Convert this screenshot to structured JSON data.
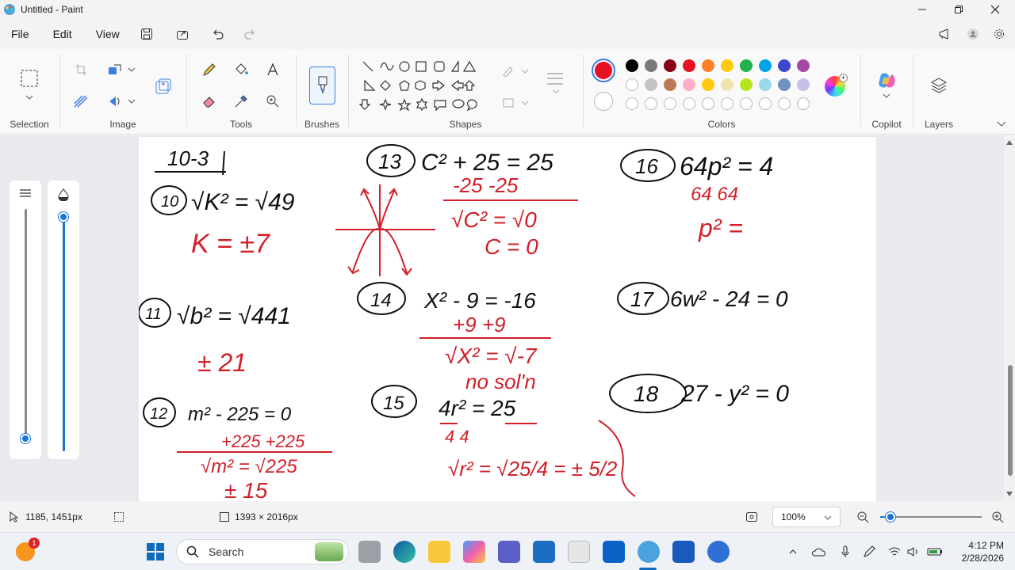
{
  "window": {
    "title": "Untitled - Paint"
  },
  "menu": {
    "file": "File",
    "edit": "Edit",
    "view": "View"
  },
  "ribbon": {
    "groups": {
      "selection": "Selection",
      "image": "Image",
      "tools": "Tools",
      "brushes": "Brushes",
      "shapes": "Shapes",
      "colors": "Colors",
      "copilot": "Copilot",
      "layers": "Layers"
    },
    "primary_color": "#e81123",
    "palette_row1": [
      "#000000",
      "#7a7a7a",
      "#880015",
      "#e81123",
      "#ff7f27",
      "#ffc90e",
      "#22b14c",
      "#00a2e8",
      "#3f48cc",
      "#a349a4"
    ],
    "palette_row2": [
      "#ffffff",
      "#c3c3c3",
      "#b97a57",
      "#ffaec9",
      "#ffc90e",
      "#efe4b0",
      "#b5e61d",
      "#99d9ea",
      "#7092be",
      "#c8bfe7"
    ]
  },
  "canvas_notes": {
    "header": "10-3",
    "problems": [
      {
        "num": "10",
        "equation": "√K² = √49",
        "work": [
          "K = ±7"
        ]
      },
      {
        "num": "11",
        "equation": "√b² = √441",
        "work": [
          "± 21"
        ]
      },
      {
        "num": "12",
        "equation": "m² - 225 = 0",
        "work": [
          "+225 +225",
          "√m² = √225",
          "± 15"
        ]
      },
      {
        "num": "13",
        "equation": "C² + 25 = 25",
        "work": [
          "-25  -25",
          "√C² = √0",
          "C = 0"
        ]
      },
      {
        "num": "14",
        "equation": "X² - 9 = -16",
        "work": [
          "+9  +9",
          "√X² = √-7",
          "no sol'n"
        ]
      },
      {
        "num": "15",
        "equation": "4r² = 25",
        "work": [
          "4      4",
          "√r² = √25/4 = ± 5/2"
        ]
      },
      {
        "num": "16",
        "equation": "64p² = 4",
        "work": [
          "64    64",
          "p² ="
        ]
      },
      {
        "num": "17",
        "equation": "6w² - 24 = 0",
        "work": []
      },
      {
        "num": "18",
        "equation": "27 - y² = 0",
        "work": []
      }
    ]
  },
  "status": {
    "cursor_pos": "1185, 1451px",
    "canvas_size": "1393 × 2016px",
    "zoom": "100%",
    "zoom_level": 0.1
  },
  "taskbar": {
    "search_placeholder": "Search",
    "notification_badge": "1",
    "time": "4:12 PM",
    "date": "2/28/2026"
  }
}
